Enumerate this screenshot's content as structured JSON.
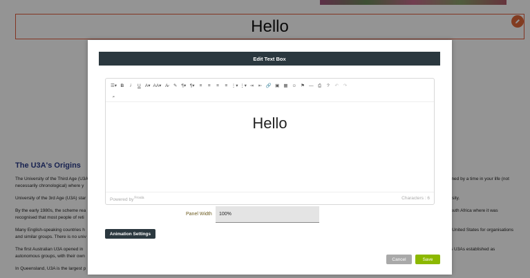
{
  "background": {
    "hello_box_text": "Hello",
    "section_title": "The U3A's Origins",
    "left_lines": [
      "The University of the Third Age (U3A",
      "necessarily chronological) where y",
      "University of the 3rd Age (U3A) star",
      "By the early 1980s, the scheme rea",
      "recognised that most people of reti",
      "Many English-speaking countries h",
      "and similar groups. There is no univ",
      "The first Australian U3A opened in",
      "autonomous groups, with their own",
      "In Queensland, U3A is the largest p"
    ],
    "right_lines": [
      "ined by a time in your life (not",
      "rsity.",
      "outh Africa where it was",
      "-United States for organisations",
      "s U3As established as"
    ]
  },
  "modal": {
    "title": "Edit Text Box",
    "toolbar": {
      "row1": [
        "☰▾",
        "B",
        "i",
        "U",
        "A▾",
        "AA▾",
        "A̷",
        "✎",
        "¶▾",
        "¶▾",
        "≡",
        "≡",
        "≡",
        "≡",
        "⋮▾",
        "⋮▾",
        "⇥",
        "⇤",
        "🔗",
        "▣",
        "▦",
        "☺",
        "⚑",
        "—",
        "⎙",
        "?",
        "↶",
        "↷"
      ],
      "row2": [
        "⌕"
      ]
    },
    "editor_text": "Hello",
    "powered_by": "Powered by",
    "powered_brand": "Froala",
    "char_count": "Characters : 6",
    "panel_width_label": "Panel Width",
    "panel_width_value": "100%",
    "animation_settings_label": "Animation Settings",
    "cancel_label": "Cancel",
    "save_label": "Save"
  }
}
